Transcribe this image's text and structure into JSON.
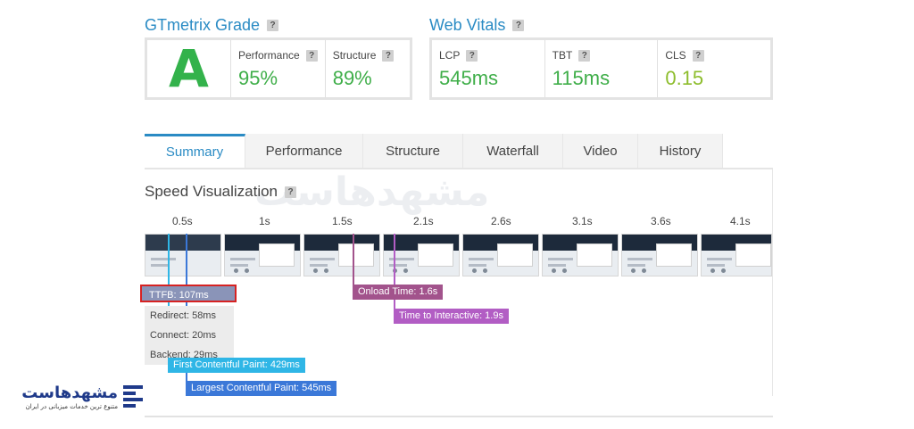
{
  "grade_section": {
    "title": "GTmetrix Grade",
    "help": "?"
  },
  "grade": {
    "letter": "A",
    "performance": {
      "label": "Performance",
      "help": "?",
      "value": "95%"
    },
    "structure": {
      "label": "Structure",
      "help": "?",
      "value": "89%"
    }
  },
  "vitals_section": {
    "title": "Web Vitals",
    "help": "?"
  },
  "vitals": {
    "lcp": {
      "label": "LCP",
      "help": "?",
      "value": "545ms"
    },
    "tbt": {
      "label": "TBT",
      "help": "?",
      "value": "115ms"
    },
    "cls": {
      "label": "CLS",
      "help": "?",
      "value": "0.15"
    }
  },
  "tabs": [
    "Summary",
    "Performance",
    "Structure",
    "Waterfall",
    "Video",
    "History"
  ],
  "speed": {
    "title": "Speed Visualization",
    "help": "?",
    "times": [
      "0.5s",
      "1s",
      "1.5s",
      "2.1s",
      "2.6s",
      "3.1s",
      "3.6s",
      "4.1s"
    ],
    "ttfb": "TTFB: 107ms",
    "redirect": "Redirect: 58ms",
    "connect": "Connect: 20ms",
    "backend": "Backend: 29ms",
    "fcp": "First Contentful Paint: 429ms",
    "lcp": "Largest Contentful Paint: 545ms",
    "onload": "Onload Time: 1.6s",
    "tti": "Time to Interactive: 1.9s"
  },
  "logo": {
    "text": "مشهدهاست",
    "tagline": "متنوع ترین خدمات میزبانی در ایران"
  },
  "colors": {
    "accent": "#2a8bc4",
    "grade_green": "#33b24b",
    "fcp": "#2fb6e6",
    "lcp": "#3b78d8",
    "onload": "#a2538c",
    "tti": "#b25dc4",
    "ttfb_bg": "#8a94b8",
    "highlight_border": "#d62222"
  }
}
